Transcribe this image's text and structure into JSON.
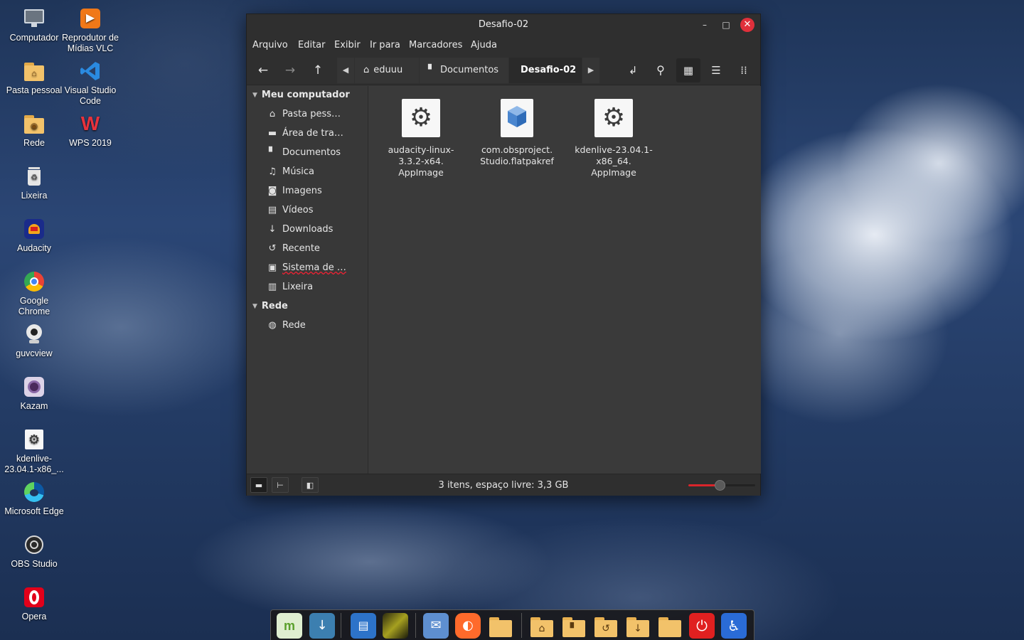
{
  "desktop": {
    "icons": [
      {
        "label": "Computador",
        "icon": "computer-icon"
      },
      {
        "label": "Reprodutor de Mídias VLC",
        "icon": "vlc-icon"
      },
      {
        "label": "Pasta pessoal",
        "icon": "home-folder-icon"
      },
      {
        "label": "Visual Studio Code",
        "icon": "vscode-icon"
      },
      {
        "label": "Rede",
        "icon": "network-folder-icon"
      },
      {
        "label": "WPS 2019",
        "icon": "wps-icon"
      },
      {
        "label": "Lixeira",
        "icon": "trash-icon"
      },
      {
        "label": "Audacity",
        "icon": "audacity-icon"
      },
      {
        "label": "Google Chrome",
        "icon": "chrome-icon"
      },
      {
        "label": "guvcview",
        "icon": "webcam-icon"
      },
      {
        "label": "Kazam",
        "icon": "kazam-icon"
      },
      {
        "label": "kdenlive-23.04.1-x86_...",
        "icon": "appimage-icon"
      },
      {
        "label": "Microsoft Edge",
        "icon": "edge-icon"
      },
      {
        "label": "OBS Studio",
        "icon": "obs-icon"
      },
      {
        "label": "Opera",
        "icon": "opera-icon"
      }
    ]
  },
  "window": {
    "title": "Desafio-02",
    "controls": {
      "minimize": "–",
      "maximize": "□",
      "close": "✕"
    },
    "menu": [
      "Arquivo",
      "Editar",
      "Exibir",
      "Ir para",
      "Marcadores",
      "Ajuda"
    ],
    "breadcrumb": {
      "items": [
        "eduuu",
        "Documentos",
        "Desafio-02"
      ],
      "current": "Desafio-02"
    },
    "sidebar": {
      "sections": [
        {
          "label": "Meu computador",
          "items": [
            {
              "label": "Pasta pess…",
              "icon": "home-icon"
            },
            {
              "label": "Área de tra…",
              "icon": "desktop-icon"
            },
            {
              "label": "Documentos",
              "icon": "document-icon"
            },
            {
              "label": "Música",
              "icon": "music-icon"
            },
            {
              "label": "Imagens",
              "icon": "camera-icon"
            },
            {
              "label": "Vídeos",
              "icon": "film-icon"
            },
            {
              "label": "Downloads",
              "icon": "download-icon"
            },
            {
              "label": "Recente",
              "icon": "history-icon"
            },
            {
              "label": "Sistema de …",
              "icon": "drive-icon"
            },
            {
              "label": "Lixeira",
              "icon": "trash-icon"
            }
          ]
        },
        {
          "label": "Rede",
          "items": [
            {
              "label": "Rede",
              "icon": "globe-icon"
            }
          ]
        }
      ]
    },
    "files": [
      {
        "line1": "audacity-linux-",
        "line2": "3.3.2-x64.",
        "line3": "AppImage",
        "icon": "gear-icon"
      },
      {
        "line1": "com.obsproject.",
        "line2": "Studio.flatpakref",
        "line3": "",
        "icon": "flatpak-icon"
      },
      {
        "line1": "kdenlive-23.04.1-",
        "line2": "x86_64.",
        "line3": "AppImage",
        "icon": "gear-icon"
      }
    ],
    "status": "3 itens, espaço livre: 3,3 GB",
    "zoom_level": 0.48
  },
  "dock": {
    "items": [
      "mint-menu-icon",
      "update-manager-icon",
      "text-editor-icon",
      "image-viewer-icon",
      "mail-icon",
      "firefox-icon",
      "files-icon",
      "home-folder-icon",
      "documents-folder-icon",
      "recent-folder-icon",
      "downloads-folder-icon",
      "folder-icon",
      "power-icon",
      "accessibility-icon"
    ]
  },
  "colors": {
    "accent": "#d9252b",
    "window_bg": "#383838",
    "toolbar_bg": "#2f2f2f"
  }
}
